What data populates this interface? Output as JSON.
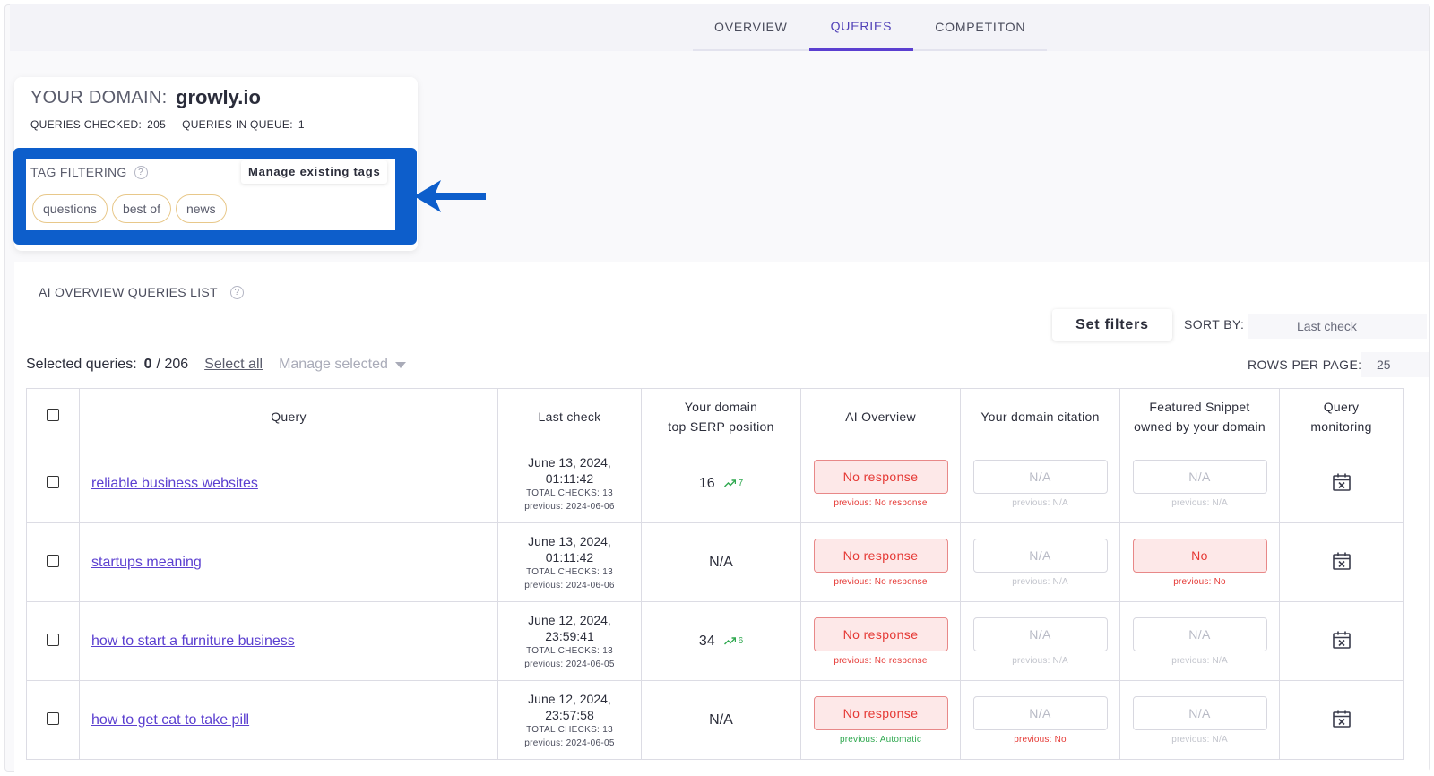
{
  "nav": {
    "tabs": [
      {
        "label": "OVERVIEW"
      },
      {
        "label": "QUERIES"
      },
      {
        "label": "COMPETITON"
      }
    ]
  },
  "domain": {
    "title": "YOUR DOMAIN:",
    "name": "growly.io",
    "queries_checked_label": "QUERIES CHECKED:",
    "queries_checked": "205",
    "queries_in_queue_label": "QUERIES IN QUEUE:",
    "queries_in_queue": "1"
  },
  "tag_filtering": {
    "label": "TAG FILTERING",
    "help": "?",
    "manage_label": "Manage existing tags",
    "tags": [
      "questions",
      "best of",
      "news"
    ]
  },
  "list": {
    "title": "AI OVERVIEW QUERIES LIST",
    "help": "?",
    "set_filters": "Set filters",
    "sort_by_label": "SORT BY:",
    "sort_by_value": "Last check",
    "selected_label": "Selected queries:",
    "selected_count": "0",
    "selected_total": "/ 206",
    "select_all": "Select all",
    "manage_selected": "Manage selected",
    "rows_per_page_label": "ROWS PER PAGE:",
    "rows_per_page": "25"
  },
  "table": {
    "headers": {
      "query": "Query",
      "last_check": "Last check",
      "serp_1": "Your domain",
      "serp_2": "top SERP position",
      "ai_overview": "AI Overview",
      "citation": "Your domain citation",
      "snippet_1": "Featured Snippet",
      "snippet_2": "owned by your domain",
      "monitoring_1": "Query",
      "monitoring_2": "monitoring"
    },
    "rows": [
      {
        "query": "reliable business websites",
        "date": "June 13, 2024,",
        "time": "01:11:42",
        "total_checks": "TOTAL CHECKS: 13",
        "previous": "previous: 2024-06-06",
        "position": "16",
        "trend": "7",
        "ai_overview": "No response",
        "ai_prev": "previous: No response",
        "citation": "N/A",
        "citation_prev": "previous: N/A",
        "snippet": "N/A",
        "snippet_prev": "previous: N/A"
      },
      {
        "query": "startups meaning",
        "date": "June 13, 2024,",
        "time": "01:11:42",
        "total_checks": "TOTAL CHECKS: 13",
        "previous": "previous: 2024-06-06",
        "position": "N/A",
        "trend": "",
        "ai_overview": "No response",
        "ai_prev": "previous: No response",
        "citation": "N/A",
        "citation_prev": "previous: N/A",
        "snippet": "No",
        "snippet_prev": "previous: No"
      },
      {
        "query": "how to start a furniture business",
        "date": "June 12, 2024,",
        "time": "23:59:41",
        "total_checks": "TOTAL CHECKS: 13",
        "previous": "previous: 2024-06-05",
        "position": "34",
        "trend": "6",
        "ai_overview": "No response",
        "ai_prev": "previous: No response",
        "citation": "N/A",
        "citation_prev": "previous: N/A",
        "snippet": "N/A",
        "snippet_prev": "previous: N/A"
      },
      {
        "query": "how to get cat to take pill",
        "date": "June 12, 2024,",
        "time": "23:57:58",
        "total_checks": "TOTAL CHECKS: 13",
        "previous": "previous: 2024-06-05",
        "position": "N/A",
        "trend": "",
        "ai_overview": "No response",
        "ai_prev": "previous: Automatic",
        "citation": "N/A",
        "citation_prev": "previous: No",
        "snippet": "N/A",
        "snippet_prev": "previous: N/A"
      }
    ]
  },
  "colors": {
    "accent": "#5b3fd0",
    "highlight_box": "#0d5ecb",
    "error": "#e53935",
    "success": "#2fa84f",
    "tag_border": "#e8c88a"
  }
}
